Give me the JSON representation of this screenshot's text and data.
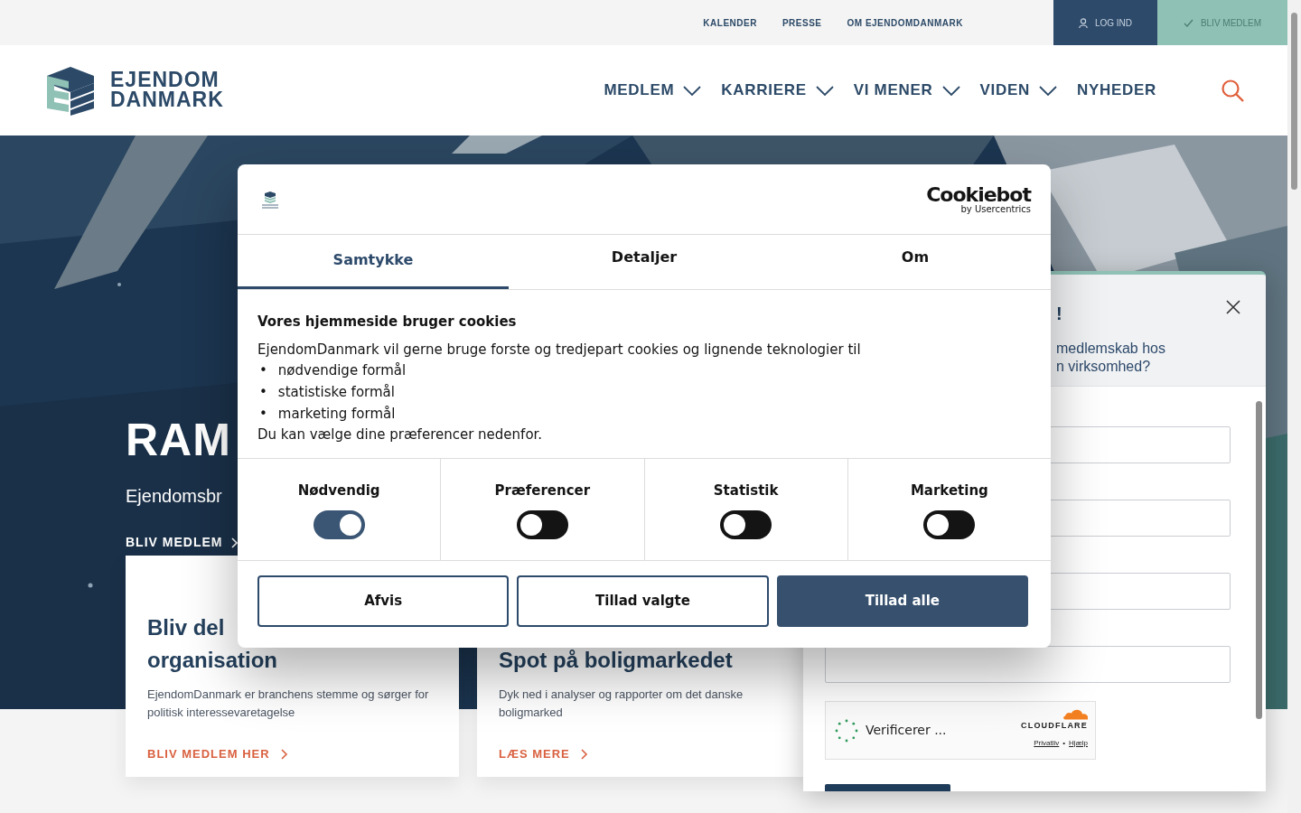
{
  "top_bar": {
    "links": [
      "KALENDER",
      "PRESSE",
      "OM EJENDOMDANMARK"
    ],
    "login": "LOG IND",
    "join": "BLIV MEDLEM"
  },
  "header": {
    "logo_lines": [
      "EJENDOM",
      "DANMARK"
    ],
    "nav": [
      {
        "label": "MEDLEM",
        "dropdown": true
      },
      {
        "label": "KARRIERE",
        "dropdown": true
      },
      {
        "label": "VI MENER",
        "dropdown": true
      },
      {
        "label": "VIDEN",
        "dropdown": true
      },
      {
        "label": "NYHEDER",
        "dropdown": false
      }
    ]
  },
  "hero": {
    "title": "RAM",
    "subtitle": "Ejendomsbr",
    "link": "BLIV MEDLEM"
  },
  "cards": [
    {
      "title_lines": [
        "Bliv del",
        "organisation"
      ],
      "text": "EjendomDanmark er branchens stemme og sørger for politisk interessevaretagelse",
      "link": "BLIV MEDLEM HER"
    },
    {
      "title_lines": [
        "Spot på boligmarkedet"
      ],
      "text": "Dyk ned i analyser og rapporter om det danske boligmarked",
      "link": "LÆS MERE"
    }
  ],
  "signup_panel": {
    "title": "!",
    "text_lines": [
      "medlemskab hos",
      "n virksomhed?"
    ],
    "fields": [
      {
        "kind": "input"
      },
      {
        "kind": "input"
      },
      {
        "kind": "input"
      },
      {
        "kind": "input"
      }
    ],
    "captcha": {
      "status": "Verificerer ...",
      "brand": "CLOUDFLARE",
      "links": [
        "Privatliv",
        "Hjælp"
      ],
      "separator": "•"
    }
  },
  "cookie_dialog": {
    "brand": "Cookiebot",
    "brand_sub": "by Usercentrics",
    "tabs": [
      {
        "label": "Samtykke",
        "selected": true
      },
      {
        "label": "Detaljer",
        "selected": false
      },
      {
        "label": "Om",
        "selected": false
      }
    ],
    "heading": "Vores hjemmeside bruger cookies",
    "intro": "EjendomDanmark vil gerne bruge forste og tredjepart cookies og lignende teknologier til",
    "purposes": [
      {
        "bullet": "•",
        "text": "nødvendige formål"
      },
      {
        "bullet": "•",
        "text": "statistiske formål"
      },
      {
        "bullet": "•",
        "text": "marketing formål"
      }
    ],
    "outro": "Du kan vælge dine præferencer nedenfor.",
    "categories": [
      {
        "label": "Nødvendig",
        "on": true
      },
      {
        "label": "Præferencer",
        "on": false
      },
      {
        "label": "Statistik",
        "on": false
      },
      {
        "label": "Marketing",
        "on": false
      }
    ],
    "buttons": [
      {
        "label": "Afvis",
        "kind": "outline"
      },
      {
        "label": "Tillad valgte",
        "kind": "outline"
      },
      {
        "label": "Tillad alle",
        "kind": "primary"
      }
    ]
  }
}
